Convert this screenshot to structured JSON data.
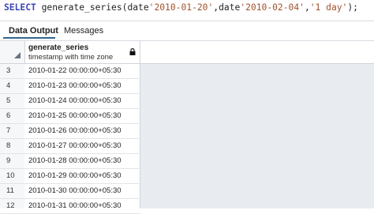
{
  "query": {
    "keyword": "SELECT",
    "func": " generate_series(",
    "d1kw": "date",
    "d1": "'2010-01-20'",
    "comma1": ",",
    "d2kw": "date",
    "d2": "'2010-02-04'",
    "comma2": ",",
    "interval": "'1 day'",
    "end": ");"
  },
  "tabs": [
    {
      "label": "Data Output"
    },
    {
      "label": "Messages"
    }
  ],
  "column": {
    "name": "generate_series",
    "type": "timestamp with time zone",
    "icon": "lock-icon"
  },
  "rows": [
    {
      "num": "3",
      "value": "2010-01-22 00:00:00+05:30"
    },
    {
      "num": "4",
      "value": "2010-01-23 00:00:00+05:30"
    },
    {
      "num": "5",
      "value": "2010-01-24 00:00:00+05:30"
    },
    {
      "num": "6",
      "value": "2010-01-25 00:00:00+05:30"
    },
    {
      "num": "7",
      "value": "2010-01-26 00:00:00+05:30"
    },
    {
      "num": "8",
      "value": "2010-01-27 00:00:00+05:30"
    },
    {
      "num": "9",
      "value": "2010-01-28 00:00:00+05:30"
    },
    {
      "num": "10",
      "value": "2010-01-29 00:00:00+05:30"
    },
    {
      "num": "11",
      "value": "2010-01-30 00:00:00+05:30"
    },
    {
      "num": "12",
      "value": "2010-01-31 00:00:00+05:30"
    }
  ]
}
